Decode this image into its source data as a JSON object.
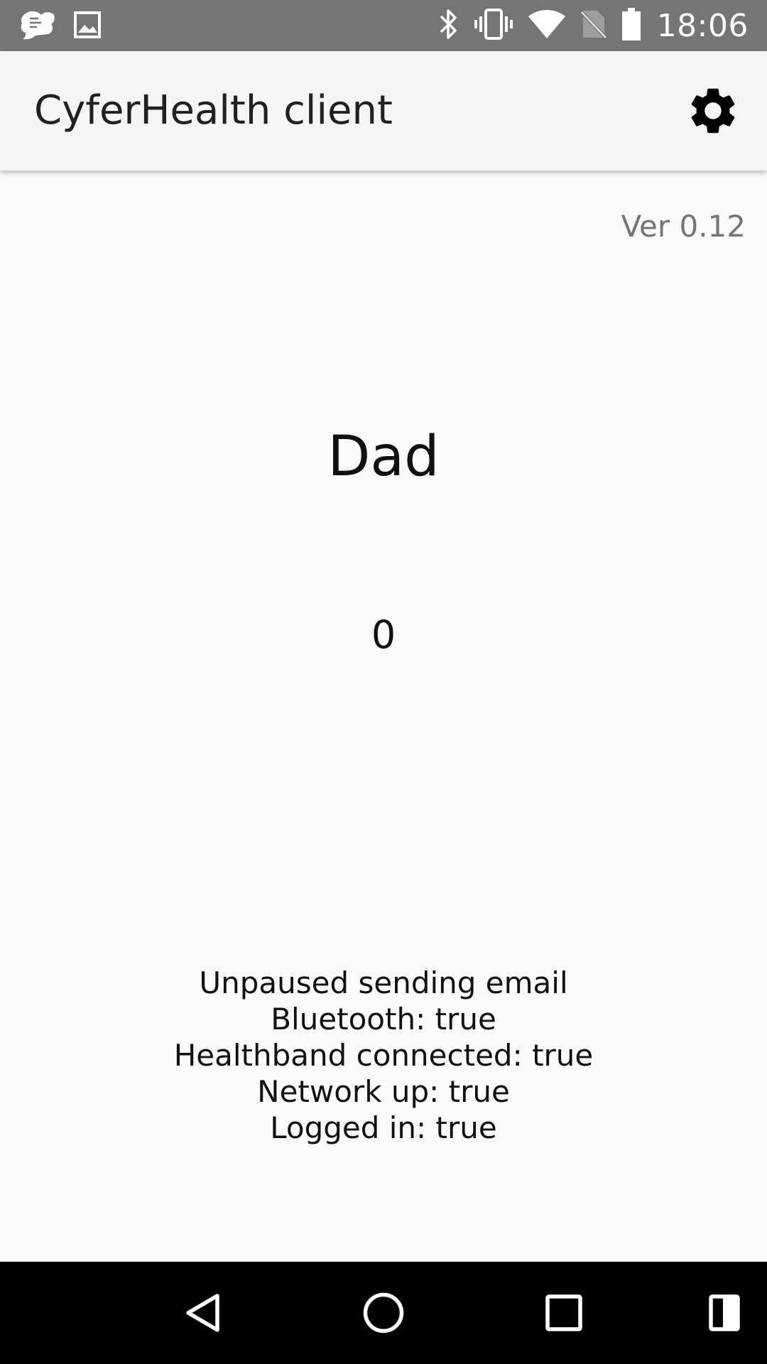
{
  "status_bar": {
    "time": "18:06",
    "left_icons": [
      "app-notification-icon",
      "image-notification-icon"
    ],
    "right_icons": [
      "bluetooth-icon",
      "vibrate-icon",
      "wifi-icon",
      "no-sim-icon",
      "battery-icon"
    ]
  },
  "app_bar": {
    "title": "CyferHealth client",
    "settings_icon": "gear-icon"
  },
  "main": {
    "version": "Ver 0.12",
    "user_name": "Dad",
    "reading": "0",
    "status_lines": [
      "Unpaused sending email",
      "Bluetooth: true",
      "Healthband connected: true",
      "Network up: true",
      "Logged in: true"
    ]
  },
  "nav_bar": {
    "buttons": [
      "back-icon",
      "home-icon",
      "recents-icon",
      "split-screen-icon"
    ]
  }
}
